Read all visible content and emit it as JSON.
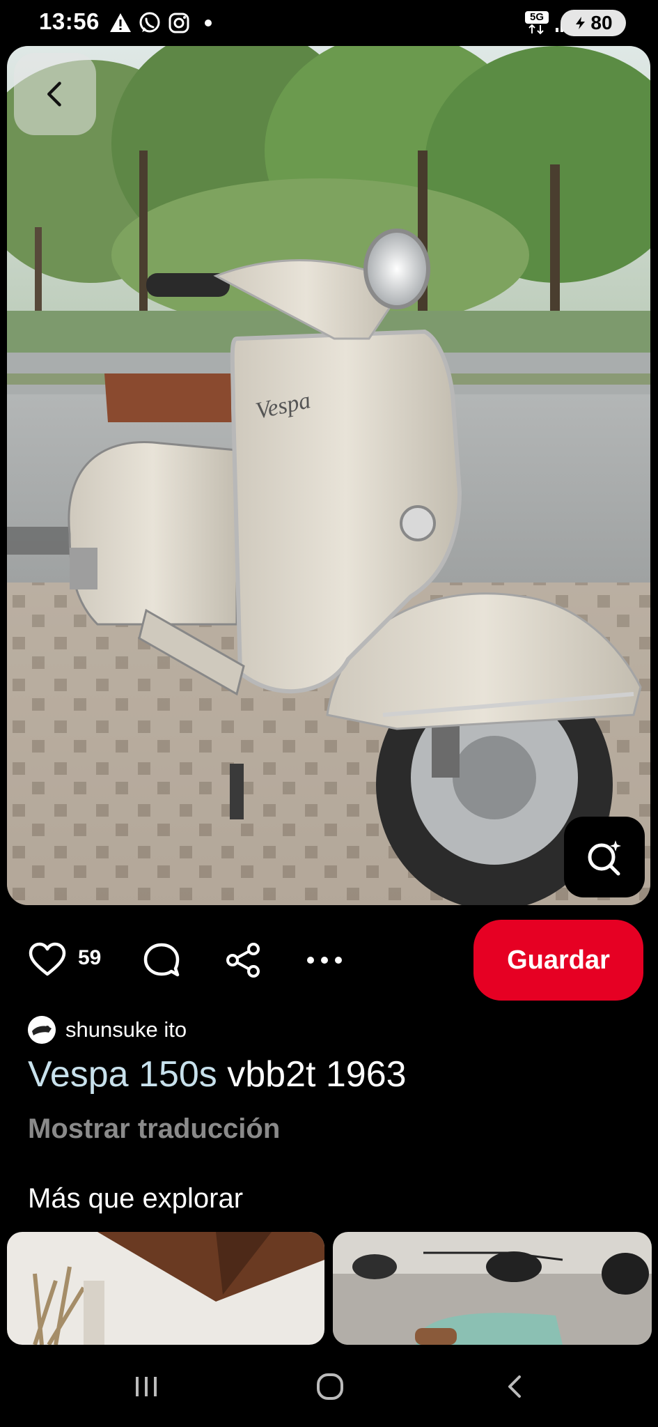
{
  "status_bar": {
    "time": "13:56",
    "network": "5G",
    "battery": "80"
  },
  "pin": {
    "likes": "59",
    "save_label": "Guardar",
    "author": "shunsuke ito",
    "title_highlight": "Vespa 150s",
    "title_rest": " vbb2t 1963",
    "translate_label": "Mostrar traducción"
  },
  "more": {
    "heading": "Más que explorar"
  },
  "colors": {
    "save_button": "#e60023",
    "title_highlight": "#c8e1ec",
    "muted_text": "#8a8a8a"
  }
}
